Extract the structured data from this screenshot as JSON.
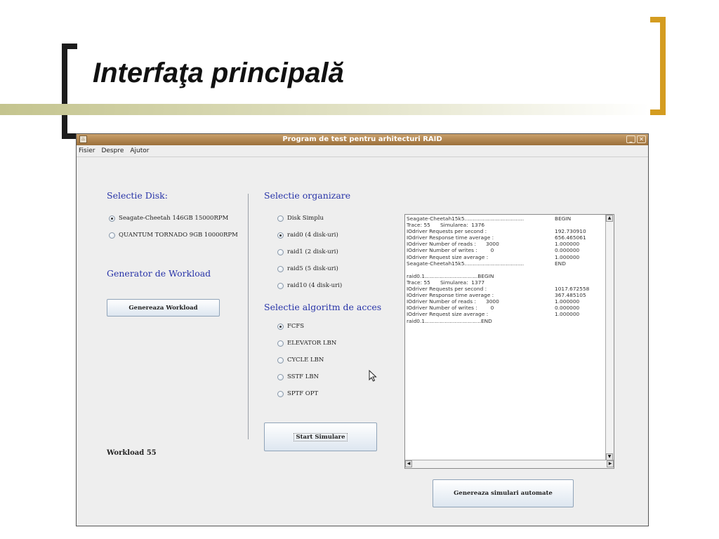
{
  "slide": {
    "title": "Interfaţa principală",
    "colors": {
      "left_bracket": "#1c1c1c",
      "right_bracket": "#d49c20",
      "title_bar": "#c4c48e"
    }
  },
  "window": {
    "title": "Program de test pentru arhitecturi RAID",
    "icon": "java-app-icon",
    "controls": [
      "minimize-icon",
      "close-icon"
    ],
    "colors": {
      "titlebar": "#b58a55",
      "background": "#eeeeee"
    }
  },
  "menubar": {
    "items": [
      "Fisier",
      "Despre",
      "Ajutor"
    ]
  },
  "disk_panel": {
    "heading": "Selectie Disk:",
    "options": [
      {
        "label": "Seagate-Cheetah 146GB 15000RPM",
        "checked": true
      },
      {
        "label": "QUANTUM TORNADO 9GB 10000RPM",
        "checked": false
      }
    ]
  },
  "workload_panel": {
    "heading": "Generator de Workload",
    "button_label": "Genereaza Workload",
    "status": "Workload 55"
  },
  "organization_panel": {
    "heading": "Selectie organizare",
    "options": [
      {
        "label": "Disk Simplu",
        "checked": false
      },
      {
        "label": "raid0 (4 disk-uri)",
        "checked": true
      },
      {
        "label": "raid1 (2 disk-uri)",
        "checked": false
      },
      {
        "label": "raid5 (5 disk-uri)",
        "checked": false
      },
      {
        "label": "raid10 (4 disk-uri)",
        "checked": false
      }
    ]
  },
  "algorithm_panel": {
    "heading": "Selectie algoritm de acces",
    "options": [
      {
        "label": "FCFS",
        "checked": true
      },
      {
        "label": "ELEVATOR LBN",
        "checked": false
      },
      {
        "label": "CYCLE LBN",
        "checked": false
      },
      {
        "label": "SSTF LBN",
        "checked": false
      },
      {
        "label": "SPTF OPT",
        "checked": false
      }
    ]
  },
  "start_button": {
    "label": "Start Simulare"
  },
  "auto_button": {
    "label": "Genereaza simulari automate"
  },
  "output_log": {
    "lines": [
      {
        "text": "Seagate-Cheetah15k5....................................",
        "value": "BEGIN"
      },
      {
        "text": "Trace: 55      Simularea:  1376",
        "value": ""
      },
      {
        "text": "IOdriver Requests per second :",
        "value": "192.730910"
      },
      {
        "text": "IOdriver Response time average :",
        "value": "656.465061"
      },
      {
        "text": "IOdriver Number of reads :      3000",
        "value": "1.000000"
      },
      {
        "text": "IOdriver Number of writes :        0",
        "value": "0.000000"
      },
      {
        "text": "IOdriver Request size average :",
        "value": "1.000000"
      },
      {
        "text": "Seagate-Cheetah15k5....................................",
        "value": "END"
      },
      {
        "text": "",
        "value": ""
      },
      {
        "text": "raid0.1................................BEGIN",
        "value": ""
      },
      {
        "text": "Trace: 55      Simularea:  1377",
        "value": ""
      },
      {
        "text": "IOdriver Requests per second :",
        "value": "1017.672558"
      },
      {
        "text": "IOdriver Response time average :",
        "value": "367.485105"
      },
      {
        "text": "IOdriver Number of reads :      3000",
        "value": "1.000000"
      },
      {
        "text": "IOdriver Number of writes :        0",
        "value": "0.000000"
      },
      {
        "text": "IOdriver Request size average :",
        "value": "1.000000"
      },
      {
        "text": "raid0.1..................................END",
        "value": ""
      }
    ]
  }
}
